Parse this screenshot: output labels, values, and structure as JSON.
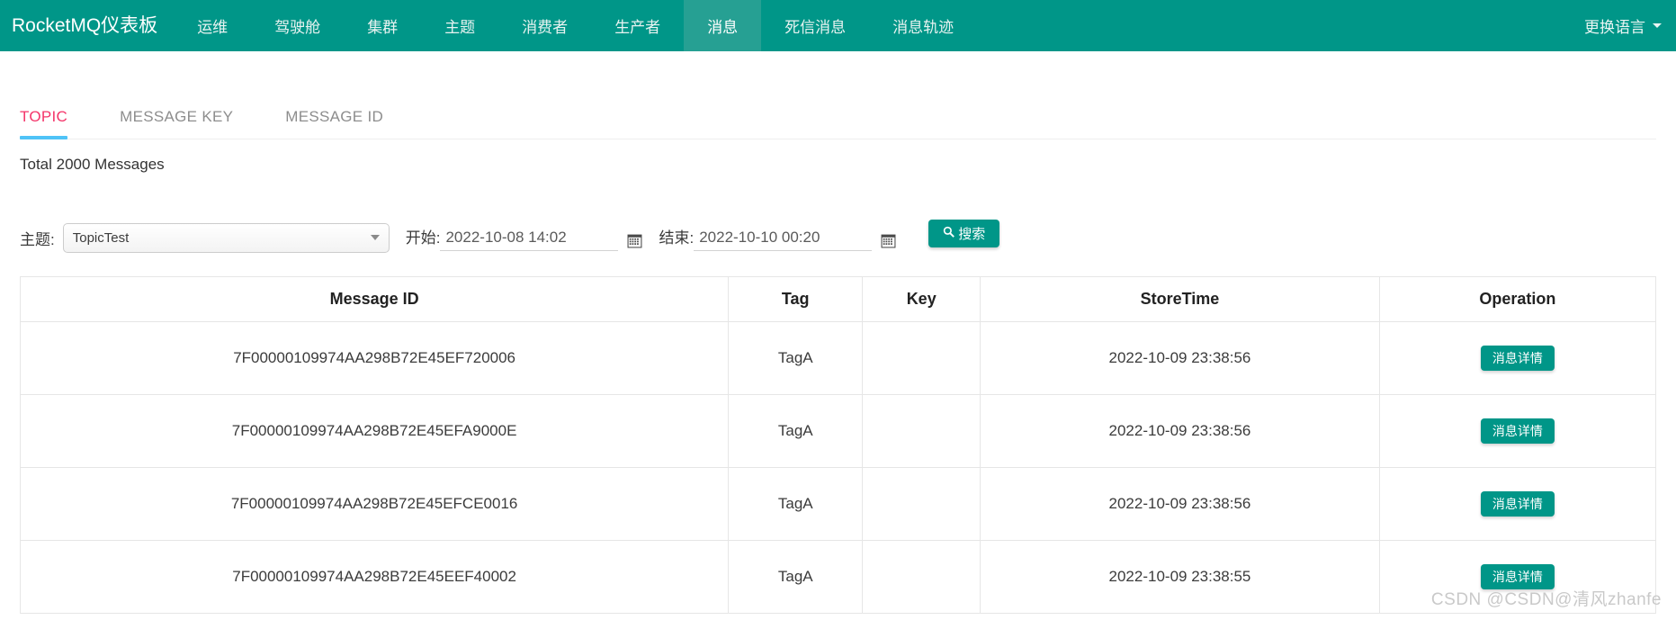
{
  "navbar": {
    "brand": "RocketMQ仪表板",
    "items": [
      {
        "label": "运维",
        "active": false
      },
      {
        "label": "驾驶舱",
        "active": false
      },
      {
        "label": "集群",
        "active": false
      },
      {
        "label": "主题",
        "active": false
      },
      {
        "label": "消费者",
        "active": false
      },
      {
        "label": "生产者",
        "active": false
      },
      {
        "label": "消息",
        "active": true
      },
      {
        "label": "死信消息",
        "active": false
      },
      {
        "label": "消息轨迹",
        "active": false
      }
    ],
    "language_label": "更换语言",
    "bg_color": "#009688",
    "active_bg_color": "#26a093"
  },
  "tabs": [
    {
      "label": "TOPIC",
      "active": true
    },
    {
      "label": "MESSAGE KEY",
      "active": false
    },
    {
      "label": "MESSAGE ID",
      "active": false
    }
  ],
  "tab_active_color": "#f4356a",
  "tab_underline_color": "#4fc3f7",
  "summary": "Total 2000 Messages",
  "filters": {
    "topic_label": "主题:",
    "topic_value": "TopicTest",
    "begin_label": "开始:",
    "begin_value": "2022-10-08 14:02",
    "end_label": "结束:",
    "end_value": "2022-10-10 00:20",
    "search_label": "搜索"
  },
  "table": {
    "columns": [
      "Message ID",
      "Tag",
      "Key",
      "StoreTime",
      "Operation"
    ],
    "operation_label": "消息详情",
    "rows": [
      {
        "message_id": "7F00000109974AA298B72E45EF720006",
        "tag": "TagA",
        "key": "",
        "store_time": "2022-10-09 23:38:56"
      },
      {
        "message_id": "7F00000109974AA298B72E45EFA9000E",
        "tag": "TagA",
        "key": "",
        "store_time": "2022-10-09 23:38:56"
      },
      {
        "message_id": "7F00000109974AA298B72E45EFCE0016",
        "tag": "TagA",
        "key": "",
        "store_time": "2022-10-09 23:38:56"
      },
      {
        "message_id": "7F00000109974AA298B72E45EEF40002",
        "tag": "TagA",
        "key": "",
        "store_time": "2022-10-09 23:38:55"
      }
    ]
  },
  "watermark": "CSDN @CSDN@清风zhanfe"
}
